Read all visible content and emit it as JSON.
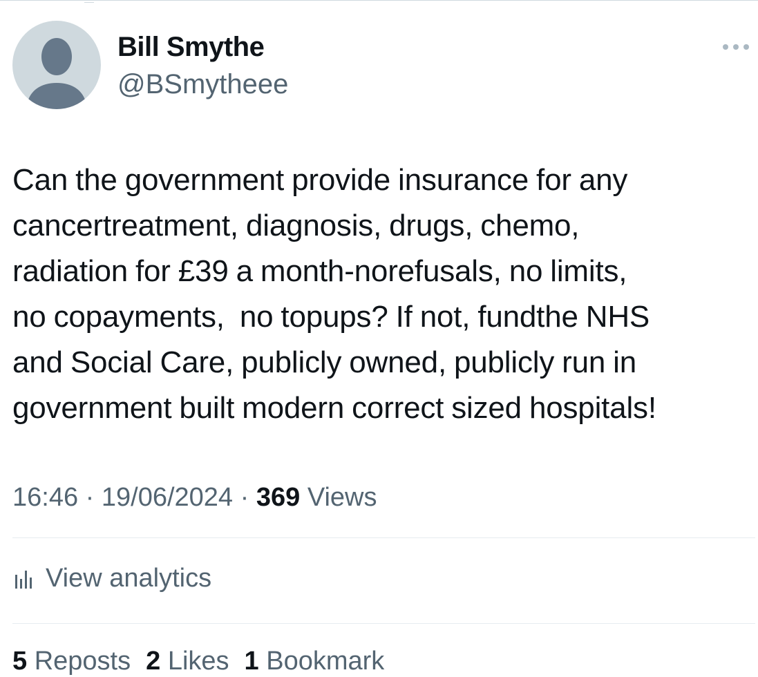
{
  "tweet": {
    "author": {
      "name": "Bill Smythe",
      "handle": "@BSmytheee"
    },
    "text": "Can the government provide insurance for any\ncancertreatment, diagnosis, drugs, chemo,\nradiation for £39 a month-norefusals, no limits,\nno copayments,  no topups? If not, fundthe NHS\nand Social Care, publicly owned, publicly run in\ngovernment built modern correct sized hospitals!",
    "time": "16:46",
    "date": "19/06/2024",
    "separator": "·",
    "views_count": "369",
    "views_label": "Views",
    "analytics_label": "View analytics",
    "stats": {
      "reposts_count": "5",
      "reposts_label": "Reposts",
      "likes_count": "2",
      "likes_label": "Likes",
      "bookmarks_count": "1",
      "bookmarks_label": "Bookmark"
    }
  },
  "icons": {
    "avatar": "default-profile-icon",
    "more": "more-horizontal-icon",
    "analytics": "analytics-bars-icon"
  },
  "colors": {
    "text_primary": "#0f1419",
    "text_secondary": "#536471",
    "avatar_bg": "#cfd9de",
    "avatar_fg": "#66788a",
    "divider": "#e6ecf0"
  }
}
